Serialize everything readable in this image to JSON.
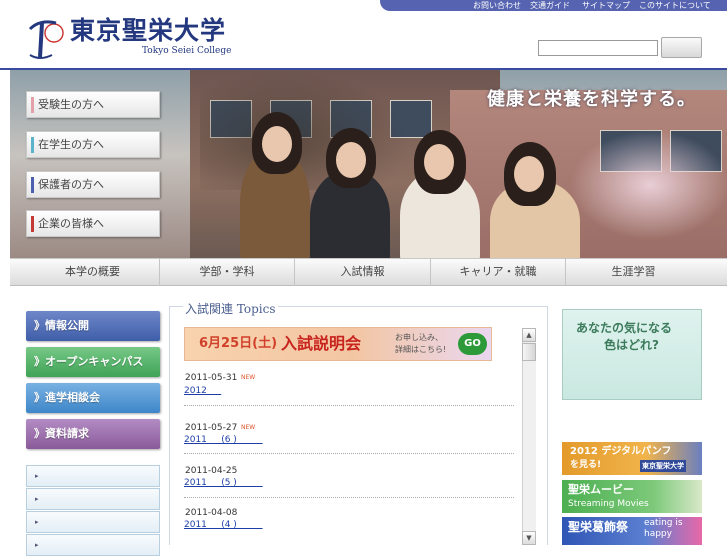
{
  "header": {
    "utility_links": [
      "お問い合わせ",
      "交通ガイド",
      "サイトマップ",
      "このサイトについて"
    ],
    "logo_mark": "TS",
    "logo_title": "東京聖栄大学",
    "logo_subtitle": "Tokyo Seiei College",
    "search": {
      "value": "",
      "button_label": ""
    }
  },
  "hero": {
    "tagline": "健康と栄養を科学する。",
    "audience_buttons": [
      {
        "label": "受験生の方へ",
        "color": "#e3a0a8"
      },
      {
        "label": "在学生の方へ",
        "color": "#5ab3c9"
      },
      {
        "label": "保護者の方へ",
        "color": "#4b5fb0"
      },
      {
        "label": "企業の皆様へ",
        "color": "#c23a36"
      }
    ]
  },
  "global_nav": [
    "本学の概要",
    "学部・学科",
    "入試情報",
    "キャリア・就職",
    "生涯学習"
  ],
  "left_menu": [
    {
      "label": "》情報公開",
      "color": "#3f5ea9"
    },
    {
      "label": "》オープンキャンパス",
      "color": "#3fa356"
    },
    {
      "label": "》進学相談会",
      "color": "#3d86c9"
    },
    {
      "label": "》資料請求",
      "color": "#8a5a9a"
    }
  ],
  "left_submenu_count": 4,
  "topics": {
    "title": "入試関連 Topics",
    "banner": {
      "date": "6月25日(土)",
      "main": "入試説明会",
      "sub_line1": "お申し込み、",
      "sub_line2": "詳細はこちら!",
      "go": "GO"
    },
    "news": [
      {
        "date": "2011-05-31",
        "new": "NEW",
        "link": "2012     "
      },
      {
        "date": "2011-05-27",
        "new": "NEW",
        "link": "2011     (6 )         "
      },
      {
        "date": "2011-04-25",
        "new": "",
        "link": "2011     (5 )         "
      },
      {
        "date": "2011-04-08",
        "new": "",
        "link": "2011     (4 )         "
      }
    ],
    "scroll_up": "▲",
    "scroll_down": "▼"
  },
  "right_column": {
    "color_quiz_line1": "あなたの気になる",
    "color_quiz_line2": "色はどれ?",
    "pamphlet_line1": "2012 デジタルパンフ",
    "pamphlet_line2": "を見る!",
    "pamphlet_brand": "東京聖栄大学",
    "movie_line1": "聖栄ムービー",
    "movie_line2": "Streaming Movies",
    "festival_title": "聖栄葛飾祭",
    "festival_tag1": "eating is",
    "festival_tag2": "happy"
  }
}
